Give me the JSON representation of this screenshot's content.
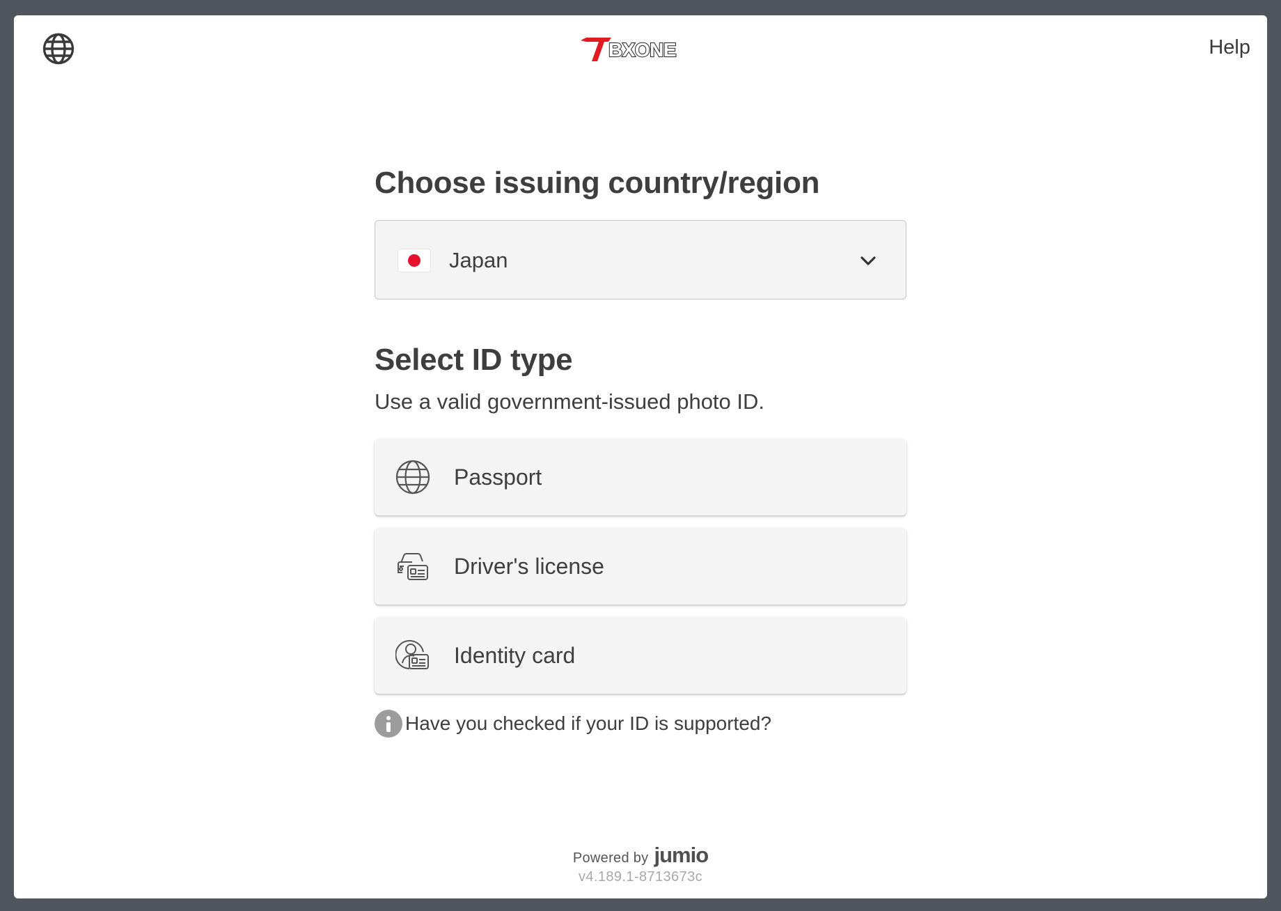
{
  "header": {
    "language_icon": "globe-icon",
    "logo_text": "BXONE",
    "help_label": "Help"
  },
  "country": {
    "heading": "Choose issuing country/region",
    "selected": "Japan",
    "flag_icon": "japan-flag-icon",
    "dropdown_icon": "chevron-down-icon"
  },
  "id_type": {
    "heading": "Select ID type",
    "subtitle": "Use a valid government-issued photo ID.",
    "options": [
      {
        "label": "Passport",
        "icon": "globe-icon"
      },
      {
        "label": "Driver's license",
        "icon": "car-card-icon"
      },
      {
        "label": "Identity card",
        "icon": "person-card-icon"
      }
    ]
  },
  "support": {
    "icon": "info-icon",
    "text": "Have you checked if your ID is supported?"
  },
  "footer": {
    "powered_by": "Powered by",
    "brand": "jumio",
    "version": "v4.189.1-8713673c"
  },
  "colors": {
    "background": "#51555d",
    "card": "#ffffff",
    "option_bg": "#f4f4f4",
    "flag_red": "#e8112d",
    "logo_red": "#e21b22"
  }
}
